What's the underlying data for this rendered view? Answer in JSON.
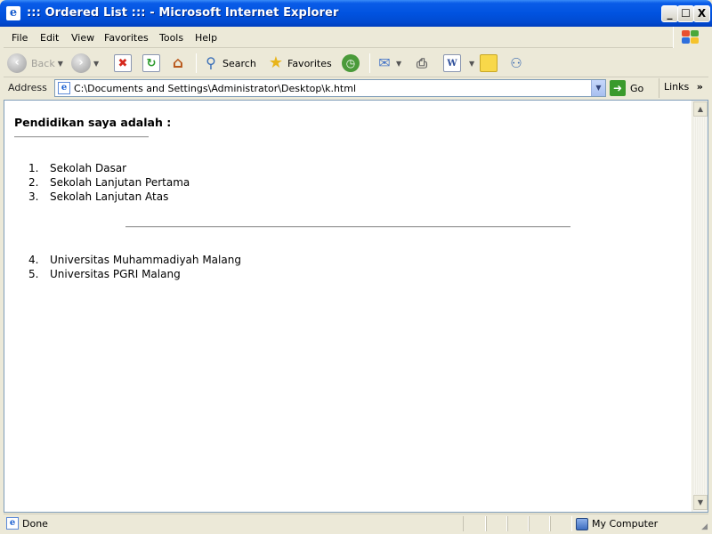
{
  "window": {
    "title": "::: Ordered List ::: - Microsoft Internet Explorer",
    "minimize_glyph": "_",
    "maximize_glyph": "☐",
    "close_glyph": "X"
  },
  "menu": {
    "items": [
      "File",
      "Edit",
      "View",
      "Favorites",
      "Tools",
      "Help"
    ]
  },
  "toolbar": {
    "back_label": "Back",
    "search_label": "Search",
    "favorites_label": "Favorites",
    "icons": [
      "back-icon",
      "forward-icon",
      "stop-icon",
      "refresh-icon",
      "home-icon",
      "search-icon",
      "favorites-icon",
      "history-icon",
      "mail-icon",
      "print-icon",
      "edit-icon",
      "discuss-icon",
      "messenger-icon"
    ]
  },
  "address": {
    "label": "Address",
    "url": "C:\\Documents and Settings\\Administrator\\Desktop\\k.html",
    "go_label": "Go",
    "links_label": "Links",
    "links_chevron": "»"
  },
  "page": {
    "heading": "Pendidikan saya adalah :",
    "list_one": [
      {
        "num": "1.",
        "text": "Sekolah Dasar"
      },
      {
        "num": "2.",
        "text": "Sekolah Lanjutan Pertama"
      },
      {
        "num": "3.",
        "text": "Sekolah Lanjutan Atas"
      }
    ],
    "list_two": [
      {
        "num": "4.",
        "text": "Universitas Muhammadiyah Malang"
      },
      {
        "num": "5.",
        "text": "Universitas PGRI Malang"
      }
    ]
  },
  "status": {
    "text": "Done",
    "zone": "My Computer"
  },
  "colors": {
    "titlebar": "#0153e0",
    "chrome": "#ece9d8",
    "go_green": "#3a9a2c"
  }
}
